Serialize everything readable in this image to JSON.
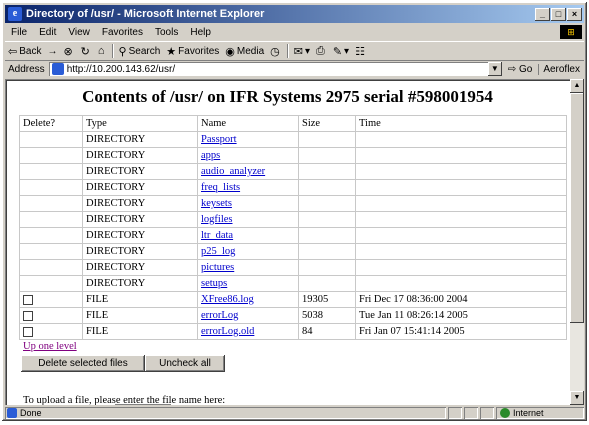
{
  "window": {
    "title": "Directory of /usr/ - Microsoft Internet Explorer",
    "controls": [
      "_",
      "□",
      "×"
    ]
  },
  "menu": [
    "File",
    "Edit",
    "View",
    "Favorites",
    "Tools",
    "Help"
  ],
  "toolbar": {
    "back": "Back",
    "forward": "→",
    "search": "Search",
    "favorites": "Favorites",
    "media": "Media"
  },
  "address": {
    "label": "Address",
    "url": "http://10.200.143.62/usr/",
    "go": "Go",
    "links": "Aeroflex"
  },
  "page": {
    "heading": "Contents of /usr/ on IFR Systems 2975 serial #598001954",
    "columns": [
      "Delete?",
      "Type",
      "Name",
      "Size",
      "Time"
    ],
    "rows": [
      {
        "checkbox": false,
        "type": "DIRECTORY",
        "name": "Passport",
        "size": "",
        "time": ""
      },
      {
        "checkbox": false,
        "type": "DIRECTORY",
        "name": "apps",
        "size": "",
        "time": ""
      },
      {
        "checkbox": false,
        "type": "DIRECTORY",
        "name": "audio_analyzer",
        "size": "",
        "time": ""
      },
      {
        "checkbox": false,
        "type": "DIRECTORY",
        "name": "freq_lists",
        "size": "",
        "time": ""
      },
      {
        "checkbox": false,
        "type": "DIRECTORY",
        "name": "keysets",
        "size": "",
        "time": ""
      },
      {
        "checkbox": false,
        "type": "DIRECTORY",
        "name": "logfiles",
        "size": "",
        "time": ""
      },
      {
        "checkbox": false,
        "type": "DIRECTORY",
        "name": "ltr_data",
        "size": "",
        "time": ""
      },
      {
        "checkbox": false,
        "type": "DIRECTORY",
        "name": "p25_log",
        "size": "",
        "time": ""
      },
      {
        "checkbox": false,
        "type": "DIRECTORY",
        "name": "pictures",
        "size": "",
        "time": ""
      },
      {
        "checkbox": false,
        "type": "DIRECTORY",
        "name": "setups",
        "size": "",
        "time": ""
      },
      {
        "checkbox": true,
        "type": "FILE",
        "name": "XFree86.log",
        "size": "19305",
        "time": "Fri Dec 17 08:36:00 2004"
      },
      {
        "checkbox": true,
        "type": "FILE",
        "name": "errorLog",
        "size": "5038",
        "time": "Tue Jan 11 08:26:14 2005"
      },
      {
        "checkbox": true,
        "type": "FILE",
        "name": "errorLog.old",
        "size": "84",
        "time": "Fri Jan 07 15:41:14 2005"
      }
    ],
    "up_link": "Up one level",
    "delete_button": "Delete selected files",
    "uncheck_button": "Uncheck all",
    "upload_text": "To upload a file, please enter the file name here:"
  },
  "status": {
    "text": "Done",
    "zone": "Internet"
  }
}
